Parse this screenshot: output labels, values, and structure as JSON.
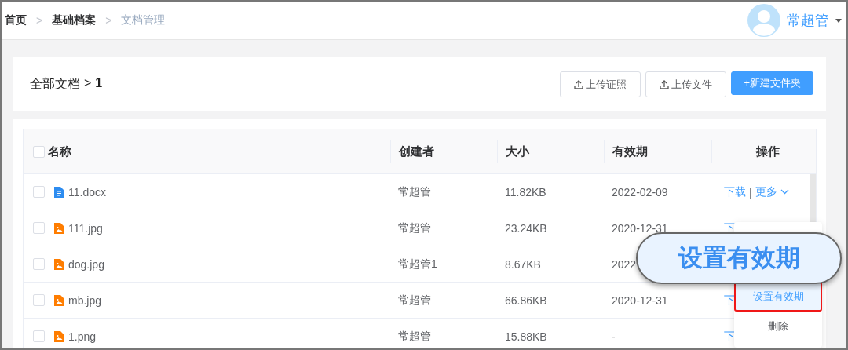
{
  "breadcrumb": [
    {
      "label": "首页",
      "current": false
    },
    {
      "label": "基础档案",
      "current": false
    },
    {
      "label": "文档管理",
      "current": true
    }
  ],
  "breadcrumb_separator": ">",
  "user": {
    "name": "常超管"
  },
  "path": {
    "root": "全部文档",
    "separator": ">",
    "folder": "1"
  },
  "toolbar_buttons": [
    {
      "label": "上传证照",
      "kind": "upload"
    },
    {
      "label": "上传文件",
      "kind": "upload"
    },
    {
      "label": "+新建文件夹",
      "kind": "primary"
    }
  ],
  "table": {
    "select_all_checked": false,
    "action_separator": "|",
    "columns": [
      "名称",
      "创建者",
      "大小",
      "有效期",
      "操作"
    ],
    "rows": [
      {
        "name": "11.docx",
        "kind": "doc",
        "checked": false,
        "creator": "常超管",
        "size": "11.82KB",
        "expiry": "2022-02-09",
        "actions": [
          {
            "label": "下载"
          },
          {
            "label": "更多",
            "dropdown": true
          }
        ]
      },
      {
        "name": "111.jpg",
        "kind": "image",
        "checked": false,
        "creator": "常超管",
        "size": "23.24KB",
        "expiry": "2020-12-31",
        "actions": [
          {
            "label": "下"
          }
        ]
      },
      {
        "name": "dog.jpg",
        "kind": "image",
        "checked": false,
        "creator": "常超管1",
        "size": "8.67KB",
        "expiry": "2022",
        "actions": []
      },
      {
        "name": "mb.jpg",
        "kind": "image",
        "checked": false,
        "creator": "常超管",
        "size": "66.86KB",
        "expiry": "2020-12-31",
        "actions": [
          {
            "label": "下"
          }
        ]
      },
      {
        "name": "1.png",
        "kind": "image",
        "checked": false,
        "creator": "常超管",
        "size": "15.88KB",
        "expiry": "-",
        "actions": [
          {
            "label": "下"
          }
        ]
      }
    ]
  },
  "more_menu": {
    "items": [
      {
        "label": "设置有效期",
        "selected": true
      },
      {
        "label": "删除",
        "selected": false
      }
    ]
  },
  "callout": {
    "text": "设置有效期"
  }
}
